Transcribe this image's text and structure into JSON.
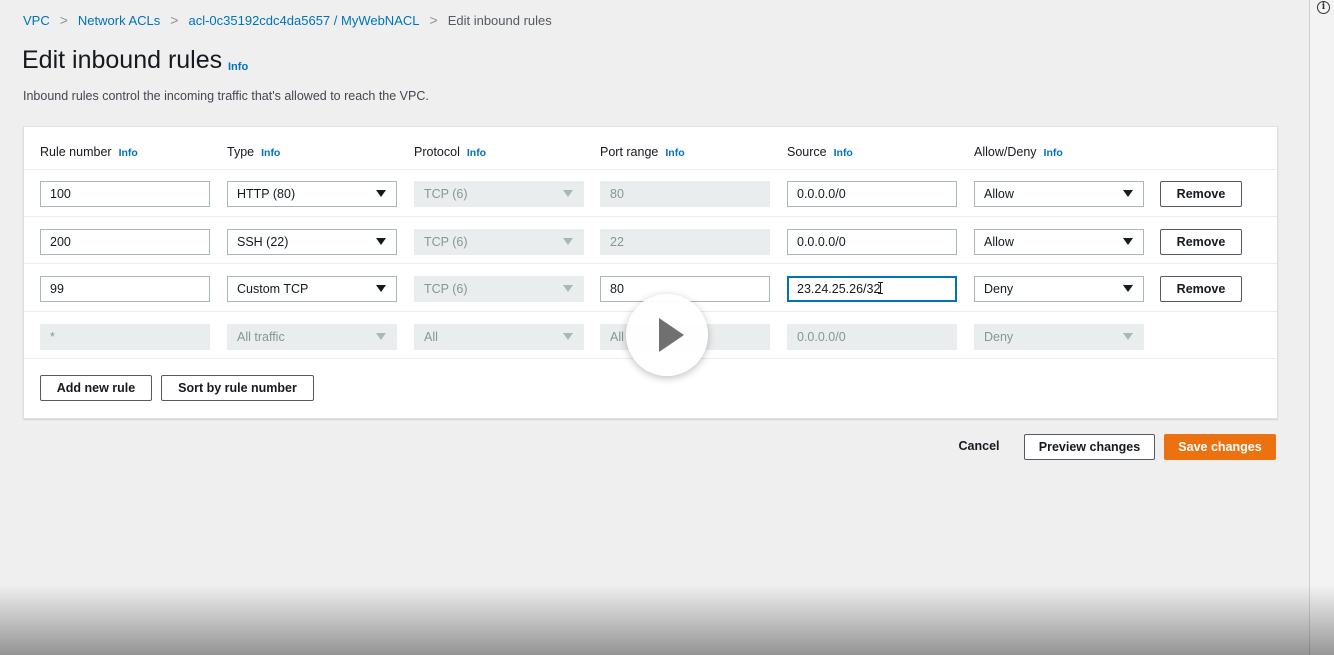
{
  "breadcrumb": [
    "VPC",
    "Network ACLs",
    "acl-0c35192cdc4da5657 / MyWebNACL",
    "Edit inbound rules"
  ],
  "page": {
    "title": "Edit inbound rules",
    "info": "Info",
    "description": "Inbound rules control the incoming traffic that's allowed to reach the VPC."
  },
  "table": {
    "headers": [
      {
        "label": "Rule number",
        "info": "Info"
      },
      {
        "label": "Type",
        "info": "Info"
      },
      {
        "label": "Protocol",
        "info": "Info"
      },
      {
        "label": "Port range",
        "info": "Info"
      },
      {
        "label": "Source",
        "info": "Info"
      },
      {
        "label": "Allow/Deny",
        "info": "Info"
      }
    ],
    "rows": [
      {
        "rule": "100",
        "type": "HTTP (80)",
        "protocol": "TCP (6)",
        "port": "80",
        "source": "0.0.0.0/0",
        "action": "Allow",
        "remove": "Remove"
      },
      {
        "rule": "200",
        "type": "SSH (22)",
        "protocol": "TCP (6)",
        "port": "22",
        "source": "0.0.0.0/0",
        "action": "Allow",
        "remove": "Remove"
      },
      {
        "rule": "99",
        "type": "Custom TCP",
        "protocol": "TCP (6)",
        "port": "80",
        "source": "23.24.25.26/32",
        "action": "Deny",
        "remove": "Remove"
      },
      {
        "rule": "*",
        "type": "All traffic",
        "protocol": "All",
        "port": "All",
        "source": "0.0.0.0/0",
        "action": "Deny"
      }
    ]
  },
  "actions": {
    "add_rule": "Add new rule",
    "sort": "Sort by rule number",
    "cancel": "Cancel",
    "preview": "Preview changes",
    "save": "Save changes"
  },
  "colors": {
    "link": "#0073bb",
    "primary": "#ec7211",
    "focus": "#0073bb"
  },
  "icons": {
    "info": "info-circle-icon",
    "dropdown": "caret-down-icon",
    "video": "play-icon"
  }
}
